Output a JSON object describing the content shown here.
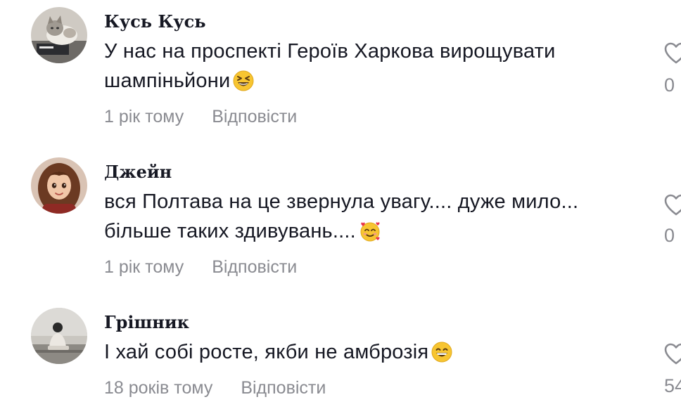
{
  "comments": [
    {
      "username": "Кусь Кусь",
      "text": "У нас на проспекті Героїв Харкова вирощувати шампіньйони",
      "emoji": "grinning-squinting-face",
      "time": "1 рік тому",
      "reply_label": "Відповісти",
      "likes": "0",
      "avatar": "cat-photo"
    },
    {
      "username": "Джейн",
      "text": "вся Полтава на це звернула увагу.... дуже мило... більше таких здивувань....",
      "emoji": "smiling-face-with-hearts",
      "time": "1 рік тому",
      "reply_label": "Відповісти",
      "likes": "0",
      "avatar": "cartoon-girl"
    },
    {
      "username": "Грішник",
      "text": "І хай собі росте, якби не амброзія",
      "emoji": "beaming-face",
      "time": "18 років тому",
      "reply_label": "Відповісти",
      "likes": "54",
      "avatar": "person-sitting-photo"
    }
  ],
  "colors": {
    "text": "#161823",
    "secondary": "#8a8b91",
    "emoji_yellow": "#f7c531"
  }
}
